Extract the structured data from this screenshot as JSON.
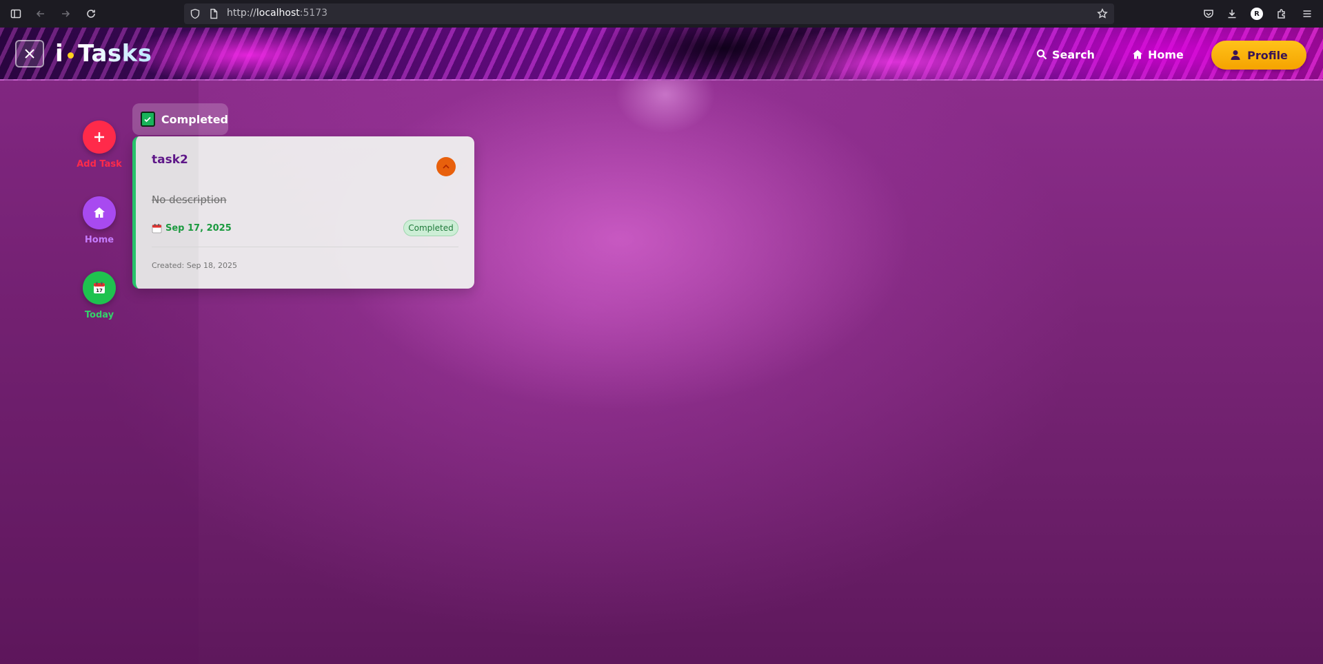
{
  "browser": {
    "url_prefix": "http://",
    "url_host": "localhost",
    "url_port": ":5173",
    "profile_initial": "R"
  },
  "header": {
    "logo_i": "i",
    "logo_tasks": "Tasks",
    "search_label": "Search",
    "home_label": "Home",
    "profile_label": "Profile"
  },
  "sidebar": {
    "items": [
      {
        "label": "Add Task",
        "color": "#ff2a4a",
        "icon": "plus-icon"
      },
      {
        "label": "Home",
        "color": "#a84af0",
        "icon": "home-icon"
      },
      {
        "label": "Today",
        "color": "#1fc24f",
        "icon": "calendar-icon"
      }
    ]
  },
  "section": {
    "label": "Completed"
  },
  "task": {
    "title": "task2",
    "description": "No description",
    "due_date": "Sep 17, 2025",
    "status": "Completed",
    "created": "Created: Sep 18, 2025"
  },
  "colors": {
    "accent_yellow": "#ffc21a",
    "completed_green": "#27c26a",
    "title_purple": "#5e1788",
    "expand_orange": "#e8600c"
  }
}
